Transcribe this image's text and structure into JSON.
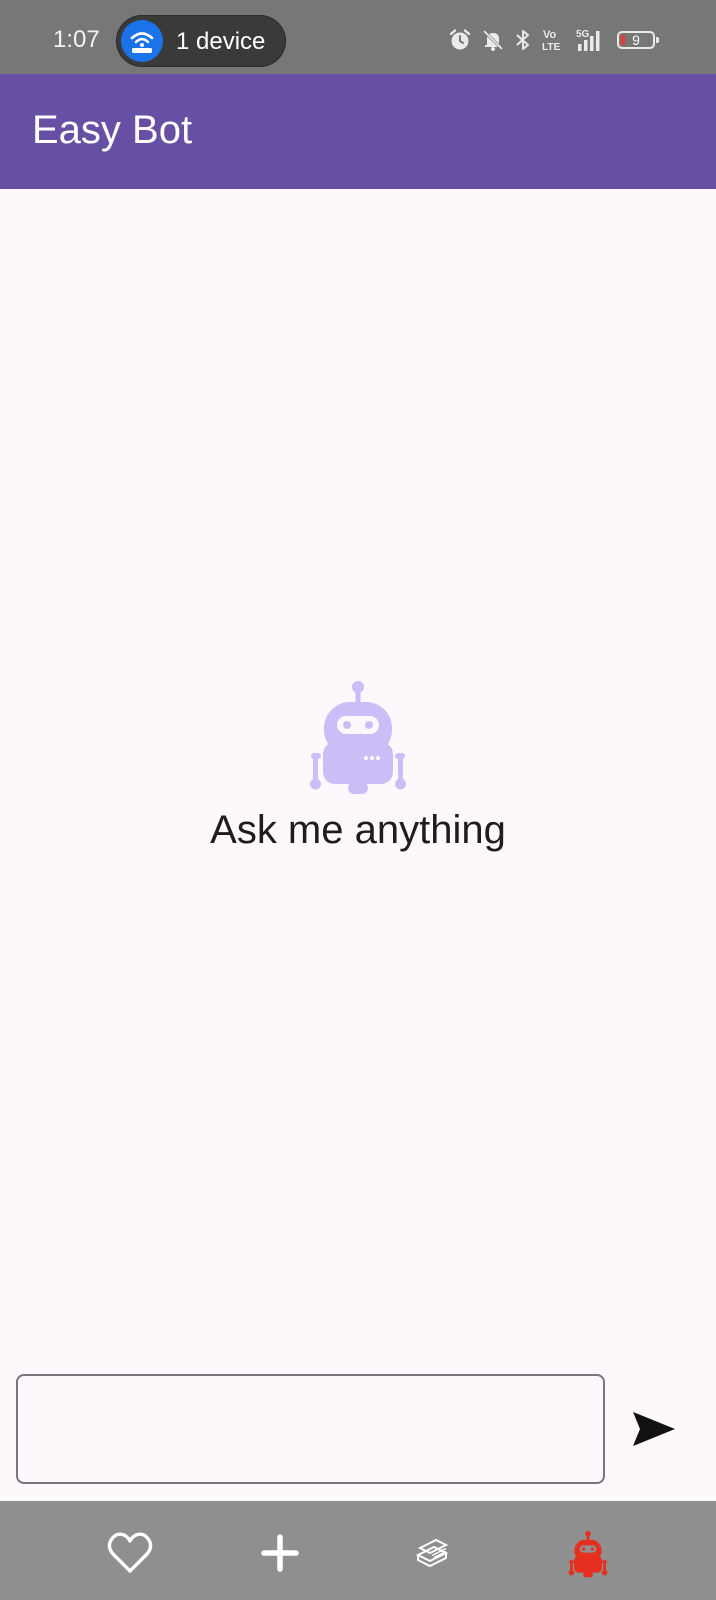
{
  "status_bar": {
    "time": "1:07",
    "hotspot_label": "1 device",
    "battery_level": "9",
    "icons": [
      "wifi-hotspot-icon",
      "alarm-icon",
      "notifications-off-icon",
      "bluetooth-icon",
      "volte-icon",
      "signal-5g-icon",
      "battery-icon"
    ]
  },
  "app_bar": {
    "title": "Easy Bot",
    "background_color": "#6750a4"
  },
  "empty_state": {
    "icon": "robot-icon",
    "icon_color": "#cdbdf7",
    "message": "Ask me anything"
  },
  "composer": {
    "input_value": "",
    "input_placeholder": "",
    "send_icon": "send-icon"
  },
  "bottom_nav": {
    "background_color": "#8f8f8f",
    "items": [
      {
        "icon": "heart-icon",
        "color": "#ffffff"
      },
      {
        "icon": "plus-icon",
        "color": "#ffffff"
      },
      {
        "icon": "book-stack-icon",
        "color": "#ffffff"
      },
      {
        "icon": "robot-icon",
        "color": "#e53020",
        "selected": true
      }
    ]
  }
}
